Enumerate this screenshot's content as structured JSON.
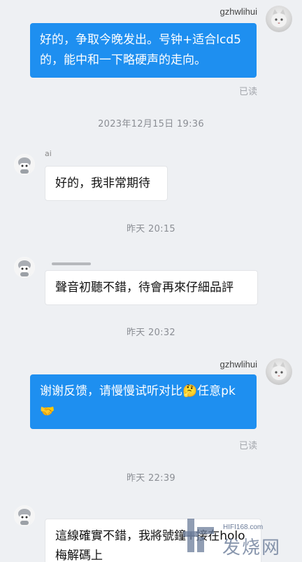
{
  "messages": [
    {
      "sender": "gzhwlihui",
      "text": "好的，争取今晚发出。号钟+适合lcd5的，能中和一下略硬声的走向。",
      "status": "已读"
    },
    {
      "timestamp": "2023年12月15日 19:36"
    },
    {
      "sender": "ai",
      "text": "好的，我非常期待"
    },
    {
      "timestamp": "昨天 20:15"
    },
    {
      "text": "聲音初聽不錯，待會再來仔細品評"
    },
    {
      "timestamp": "昨天 20:32"
    },
    {
      "sender": "gzhwlihui",
      "text": "谢谢反馈，请慢慢试听对比🤔任意pk🤝",
      "status": "已读"
    },
    {
      "timestamp": "昨天 22:39"
    },
    {
      "text": "這線確實不錯，我將號鐘+接在holo梅解碼上"
    }
  ],
  "watermark": {
    "url": "HIFI168.com",
    "name": "发烧网"
  },
  "colors": {
    "accent": "#1e8ff0",
    "background": "#eef0f3"
  },
  "icons": {
    "outgoing_avatar": "cat-avatar-icon",
    "incoming_avatar": "robot-avatar-icon"
  }
}
